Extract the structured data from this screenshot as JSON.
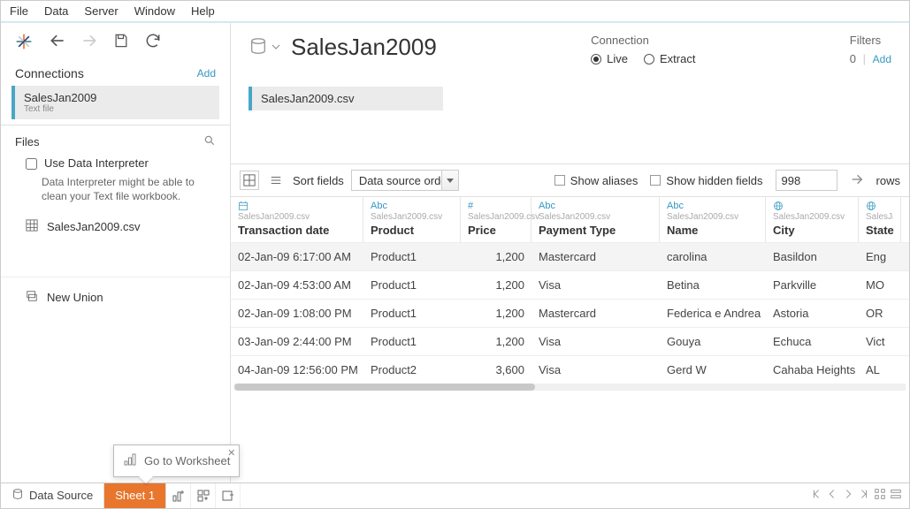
{
  "menu": {
    "file": "File",
    "data": "Data",
    "server": "Server",
    "window": "Window",
    "help": "Help"
  },
  "connections": {
    "header": "Connections",
    "add": "Add"
  },
  "conn_item": {
    "name": "SalesJan2009",
    "type": "Text file"
  },
  "files": {
    "header": "Files"
  },
  "interpreter": {
    "label": "Use Data Interpreter",
    "hint": "Data Interpreter might be able to clean your Text file workbook."
  },
  "file_entry": "SalesJan2009.csv",
  "new_union": "New Union",
  "ds": {
    "title": "SalesJan2009"
  },
  "pill": "SalesJan2009.csv",
  "connection": {
    "header": "Connection",
    "live": "Live",
    "extract": "Extract"
  },
  "filters": {
    "header": "Filters",
    "count": "0",
    "add": "Add"
  },
  "grid_ctrl": {
    "sort_label": "Sort fields",
    "sort_value": "Data source order",
    "show_aliases": "Show aliases",
    "show_hidden": "Show hidden fields",
    "count": "998",
    "rows": "rows"
  },
  "col_src": "SalesJan2009.csv",
  "cols": {
    "c0": "Transaction date",
    "c1": "Product",
    "c2": "Price",
    "c3": "Payment Type",
    "c4": "Name",
    "c5": "City",
    "c6": "State"
  },
  "types": {
    "c0": "date",
    "c1": "Abc",
    "c2": "#",
    "c3": "Abc",
    "c4": "Abc",
    "c5": "geo",
    "c6": "geo"
  },
  "rows": [
    {
      "date": "02-Jan-09 6:17:00 AM",
      "product": "Product1",
      "price": "1,200",
      "ptype": "Mastercard",
      "name": "carolina",
      "city": "Basildon",
      "state": "Eng"
    },
    {
      "date": "02-Jan-09 4:53:00 AM",
      "product": "Product1",
      "price": "1,200",
      "ptype": "Visa",
      "name": "Betina",
      "city": "Parkville",
      "state": "MO"
    },
    {
      "date": "02-Jan-09 1:08:00 PM",
      "product": "Product1",
      "price": "1,200",
      "ptype": "Mastercard",
      "name": "Federica e Andrea",
      "city": "Astoria",
      "state": "OR"
    },
    {
      "date": "03-Jan-09 2:44:00 PM",
      "product": "Product1",
      "price": "1,200",
      "ptype": "Visa",
      "name": "Gouya",
      "city": "Echuca",
      "state": "Vict"
    },
    {
      "date": "04-Jan-09 12:56:00 PM",
      "product": "Product2",
      "price": "3,600",
      "ptype": "Visa",
      "name": "Gerd W",
      "city": "Cahaba Heights",
      "state": "AL"
    }
  ],
  "tabs": {
    "data_source": "Data Source",
    "sheet1": "Sheet 1"
  },
  "tooltip": "Go to Worksheet"
}
